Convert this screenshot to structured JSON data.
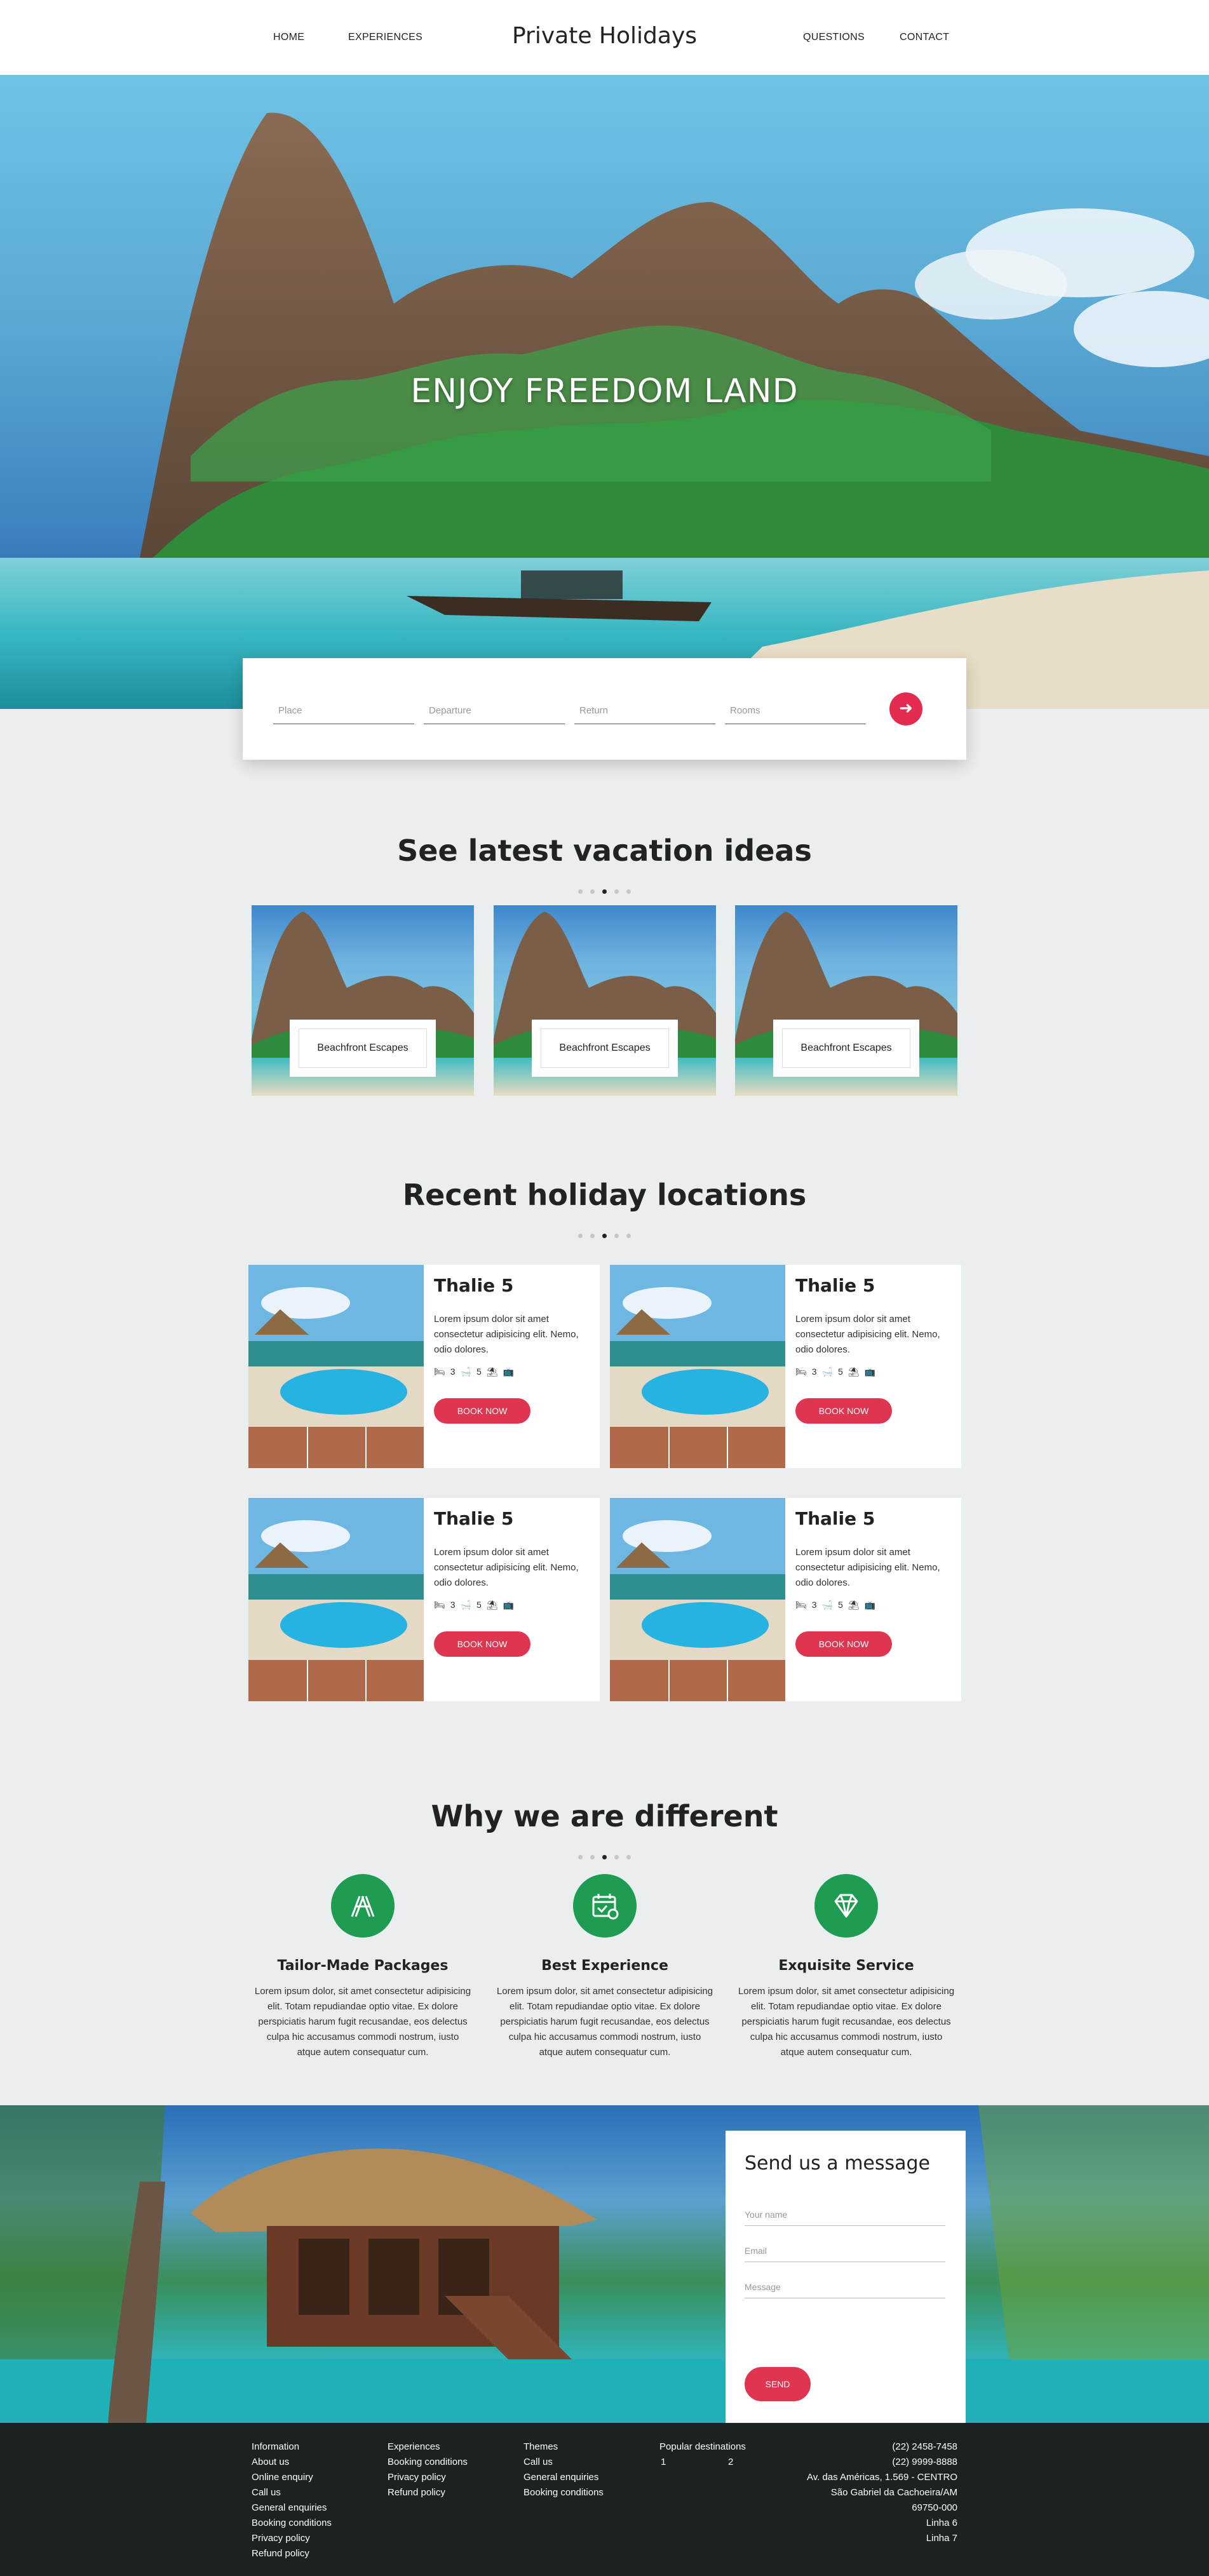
{
  "nav": {
    "home": "HOME",
    "experiences": "EXPERIENCES",
    "brand": "Private Holidays",
    "questions": "QUESTIONS",
    "contact": "CONTACT"
  },
  "hero": {
    "title": "ENJOY FREEDOM LAND"
  },
  "search": {
    "place": "Place",
    "departure": "Departure",
    "return": "Return",
    "rooms": "Rooms",
    "go_icon": "arrow-right-icon"
  },
  "ideas": {
    "title": "See latest vacation ideas",
    "cards": [
      {
        "label": "Beachfront Escapes"
      },
      {
        "label": "Beachfront Escapes"
      },
      {
        "label": "Beachfront Escapes"
      }
    ]
  },
  "locations": {
    "title": "Recent holiday locations",
    "cards": [
      {
        "name": "Thalie 5",
        "desc": "Lorem ipsum dolor sit amet consectetur adipisicing elit. Nemo, odio dolores.",
        "beds": "3",
        "baths": "5",
        "button": "BOOK NOW"
      },
      {
        "name": "Thalie 5",
        "desc": "Lorem ipsum dolor sit amet consectetur adipisicing elit. Nemo, odio dolores.",
        "beds": "3",
        "baths": "5",
        "button": "BOOK NOW"
      },
      {
        "name": "Thalie 5",
        "desc": "Lorem ipsum dolor sit amet consectetur adipisicing elit. Nemo, odio dolores.",
        "beds": "3",
        "baths": "5",
        "button": "BOOK NOW"
      },
      {
        "name": "Thalie 5",
        "desc": "Lorem ipsum dolor sit amet consectetur adipisicing elit. Nemo, odio dolores.",
        "beds": "3",
        "baths": "5",
        "button": "BOOK NOW"
      }
    ]
  },
  "features": {
    "title": "Why we are different",
    "items": [
      {
        "title": "Tailor-Made Packages",
        "text": "Lorem ipsum dolor, sit amet consectetur adipisicing elit. Totam repudiandae optio vitae. Ex dolore perspiciatis harum fugit recusandae, eos delectus culpa hic accusamus commodi nostrum, iusto atque autem consequatur cum.",
        "icon": "tools-icon"
      },
      {
        "title": "Best Experience",
        "text": "Lorem ipsum dolor, sit amet consectetur adipisicing elit. Totam repudiandae optio vitae. Ex dolore perspiciatis harum fugit recusandae, eos delectus culpa hic accusamus commodi nostrum, iusto atque autem consequatur cum.",
        "icon": "calendar-check-icon"
      },
      {
        "title": "Exquisite Service",
        "text": "Lorem ipsum dolor, sit amet consectetur adipisicing elit. Totam repudiandae optio vitae. Ex dolore perspiciatis harum fugit recusandae, eos delectus culpa hic accusamus commodi nostrum, iusto atque autem consequatur cum.",
        "icon": "diamond-icon"
      }
    ]
  },
  "contact_form": {
    "title": "Send us a message",
    "name": "Your name",
    "email": "Email",
    "message": "Message",
    "send": "SEND"
  },
  "footer": {
    "col1": [
      "Information",
      "About us",
      "Online enquiry",
      "Call us",
      "General enquiries",
      "Booking conditions",
      "Privacy policy",
      "Refund policy"
    ],
    "col2": [
      "Experiences",
      "Booking conditions",
      "Privacy policy",
      "Refund policy"
    ],
    "col3": [
      "Themes",
      "Call us",
      "General enquiries",
      "Booking conditions"
    ],
    "col4": {
      "title": "Popular destinations",
      "pages": [
        "1",
        "2"
      ]
    },
    "address": [
      "(22) 2458-7458",
      "(22) 9999-8888",
      "Av. das Américas, 1.569 - CENTRO",
      "São Gabriel da Cachoeira/AM",
      "69750-000",
      "Linha 6",
      "Linha 7"
    ]
  },
  "colors": {
    "accent": "#e03550",
    "feature_green": "#1e9c52",
    "footer_bg": "#1c2123",
    "page_bg": "#ebeeee"
  }
}
